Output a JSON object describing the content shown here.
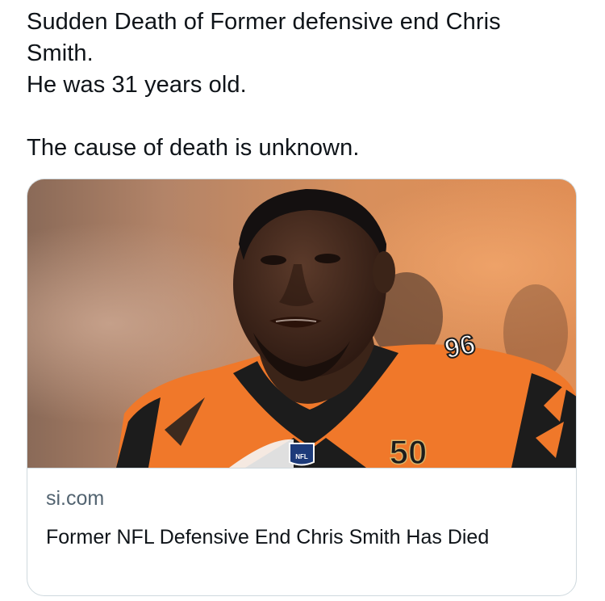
{
  "tweet": {
    "lines": [
      "Sudden Death of Former defensive end Chris",
      "Smith.",
      "He was 31 years old.",
      "",
      "The cause of death is unknown."
    ]
  },
  "card": {
    "image_alt": "Photo of player in orange and black jersey number 96",
    "jersey_number": "96",
    "patch_number": "50",
    "shield_text": "NFL",
    "domain": "si.com",
    "title": "Former NFL Defensive End Chris Smith Has Died"
  },
  "colors": {
    "text": "#0f1419",
    "secondary_text": "#536471",
    "border": "#cfd9de",
    "jersey_orange": "#f0782a",
    "jersey_black": "#1c1c1c"
  }
}
